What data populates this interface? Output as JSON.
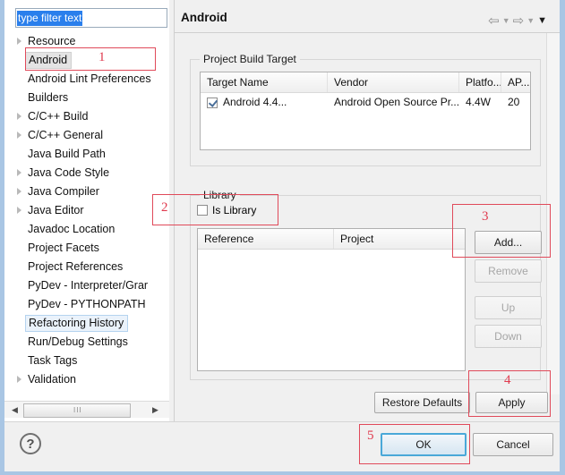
{
  "window": {
    "title": "Android"
  },
  "filter": {
    "value": "type filter text",
    "placeholder": "type filter text"
  },
  "tree": {
    "items": [
      {
        "label": "Resource",
        "arrow": true,
        "state": "normal"
      },
      {
        "label": "Android",
        "arrow": false,
        "state": "selected"
      },
      {
        "label": "Android Lint Preferences",
        "arrow": false,
        "state": "normal"
      },
      {
        "label": "Builders",
        "arrow": false,
        "state": "normal"
      },
      {
        "label": "C/C++ Build",
        "arrow": true,
        "state": "normal"
      },
      {
        "label": "C/C++ General",
        "arrow": true,
        "state": "normal"
      },
      {
        "label": "Java Build Path",
        "arrow": false,
        "state": "normal"
      },
      {
        "label": "Java Code Style",
        "arrow": true,
        "state": "normal"
      },
      {
        "label": "Java Compiler",
        "arrow": true,
        "state": "normal"
      },
      {
        "label": "Java Editor",
        "arrow": true,
        "state": "normal"
      },
      {
        "label": "Javadoc Location",
        "arrow": false,
        "state": "normal"
      },
      {
        "label": "Project Facets",
        "arrow": false,
        "state": "normal"
      },
      {
        "label": "Project References",
        "arrow": false,
        "state": "normal"
      },
      {
        "label": "PyDev - Interpreter/Grar",
        "arrow": false,
        "state": "normal"
      },
      {
        "label": "PyDev - PYTHONPATH",
        "arrow": false,
        "state": "normal"
      },
      {
        "label": "Refactoring History",
        "arrow": false,
        "state": "focusbox"
      },
      {
        "label": "Run/Debug Settings",
        "arrow": false,
        "state": "normal"
      },
      {
        "label": "Task Tags",
        "arrow": false,
        "state": "normal"
      },
      {
        "label": "Validation",
        "arrow": true,
        "state": "normal"
      }
    ]
  },
  "header": {
    "back_icon": "back-arrow-icon",
    "back_dropdown": "chevron-down-icon",
    "forward_icon": "forward-arrow-icon",
    "forward_dropdown": "chevron-down-icon",
    "menu_dropdown": "chevron-down-icon",
    "glyph_back": "⇦",
    "glyph_forward": "⇨",
    "glyph_chevron": "▼"
  },
  "build_target": {
    "group_title": "Project Build Target",
    "columns": [
      "Target Name",
      "Vendor",
      "Platfo...",
      "AP..."
    ],
    "rows": [
      {
        "checked": true,
        "target_name": "Android 4.4...",
        "vendor": "Android Open Source Pr...",
        "platform": "4.4W",
        "api": "20"
      }
    ]
  },
  "library": {
    "group_title": "Library",
    "is_library_label": "Is Library",
    "is_library_checked": false,
    "columns": [
      "Reference",
      "Project"
    ],
    "rows": [],
    "buttons": [
      {
        "label": "Add...",
        "enabled": true
      },
      {
        "label": "Remove",
        "enabled": false
      },
      {
        "label": "Up",
        "enabled": false
      },
      {
        "label": "Down",
        "enabled": false
      }
    ]
  },
  "footer": {
    "restore_defaults": "Restore Defaults",
    "apply": "Apply",
    "ok": "OK",
    "cancel": "Cancel",
    "help_glyph": "?"
  },
  "scrollbar": {
    "left_arrow": "◀",
    "right_arrow": "▶",
    "grip": "III"
  },
  "annotations": [
    {
      "number": "1"
    },
    {
      "number": "2"
    },
    {
      "number": "3"
    },
    {
      "number": "4"
    },
    {
      "number": "5"
    }
  ],
  "colors": {
    "annotation_red": "#e03a4e",
    "selection_blue": "#2a7fec",
    "default_button_border": "#4aa8d8"
  }
}
